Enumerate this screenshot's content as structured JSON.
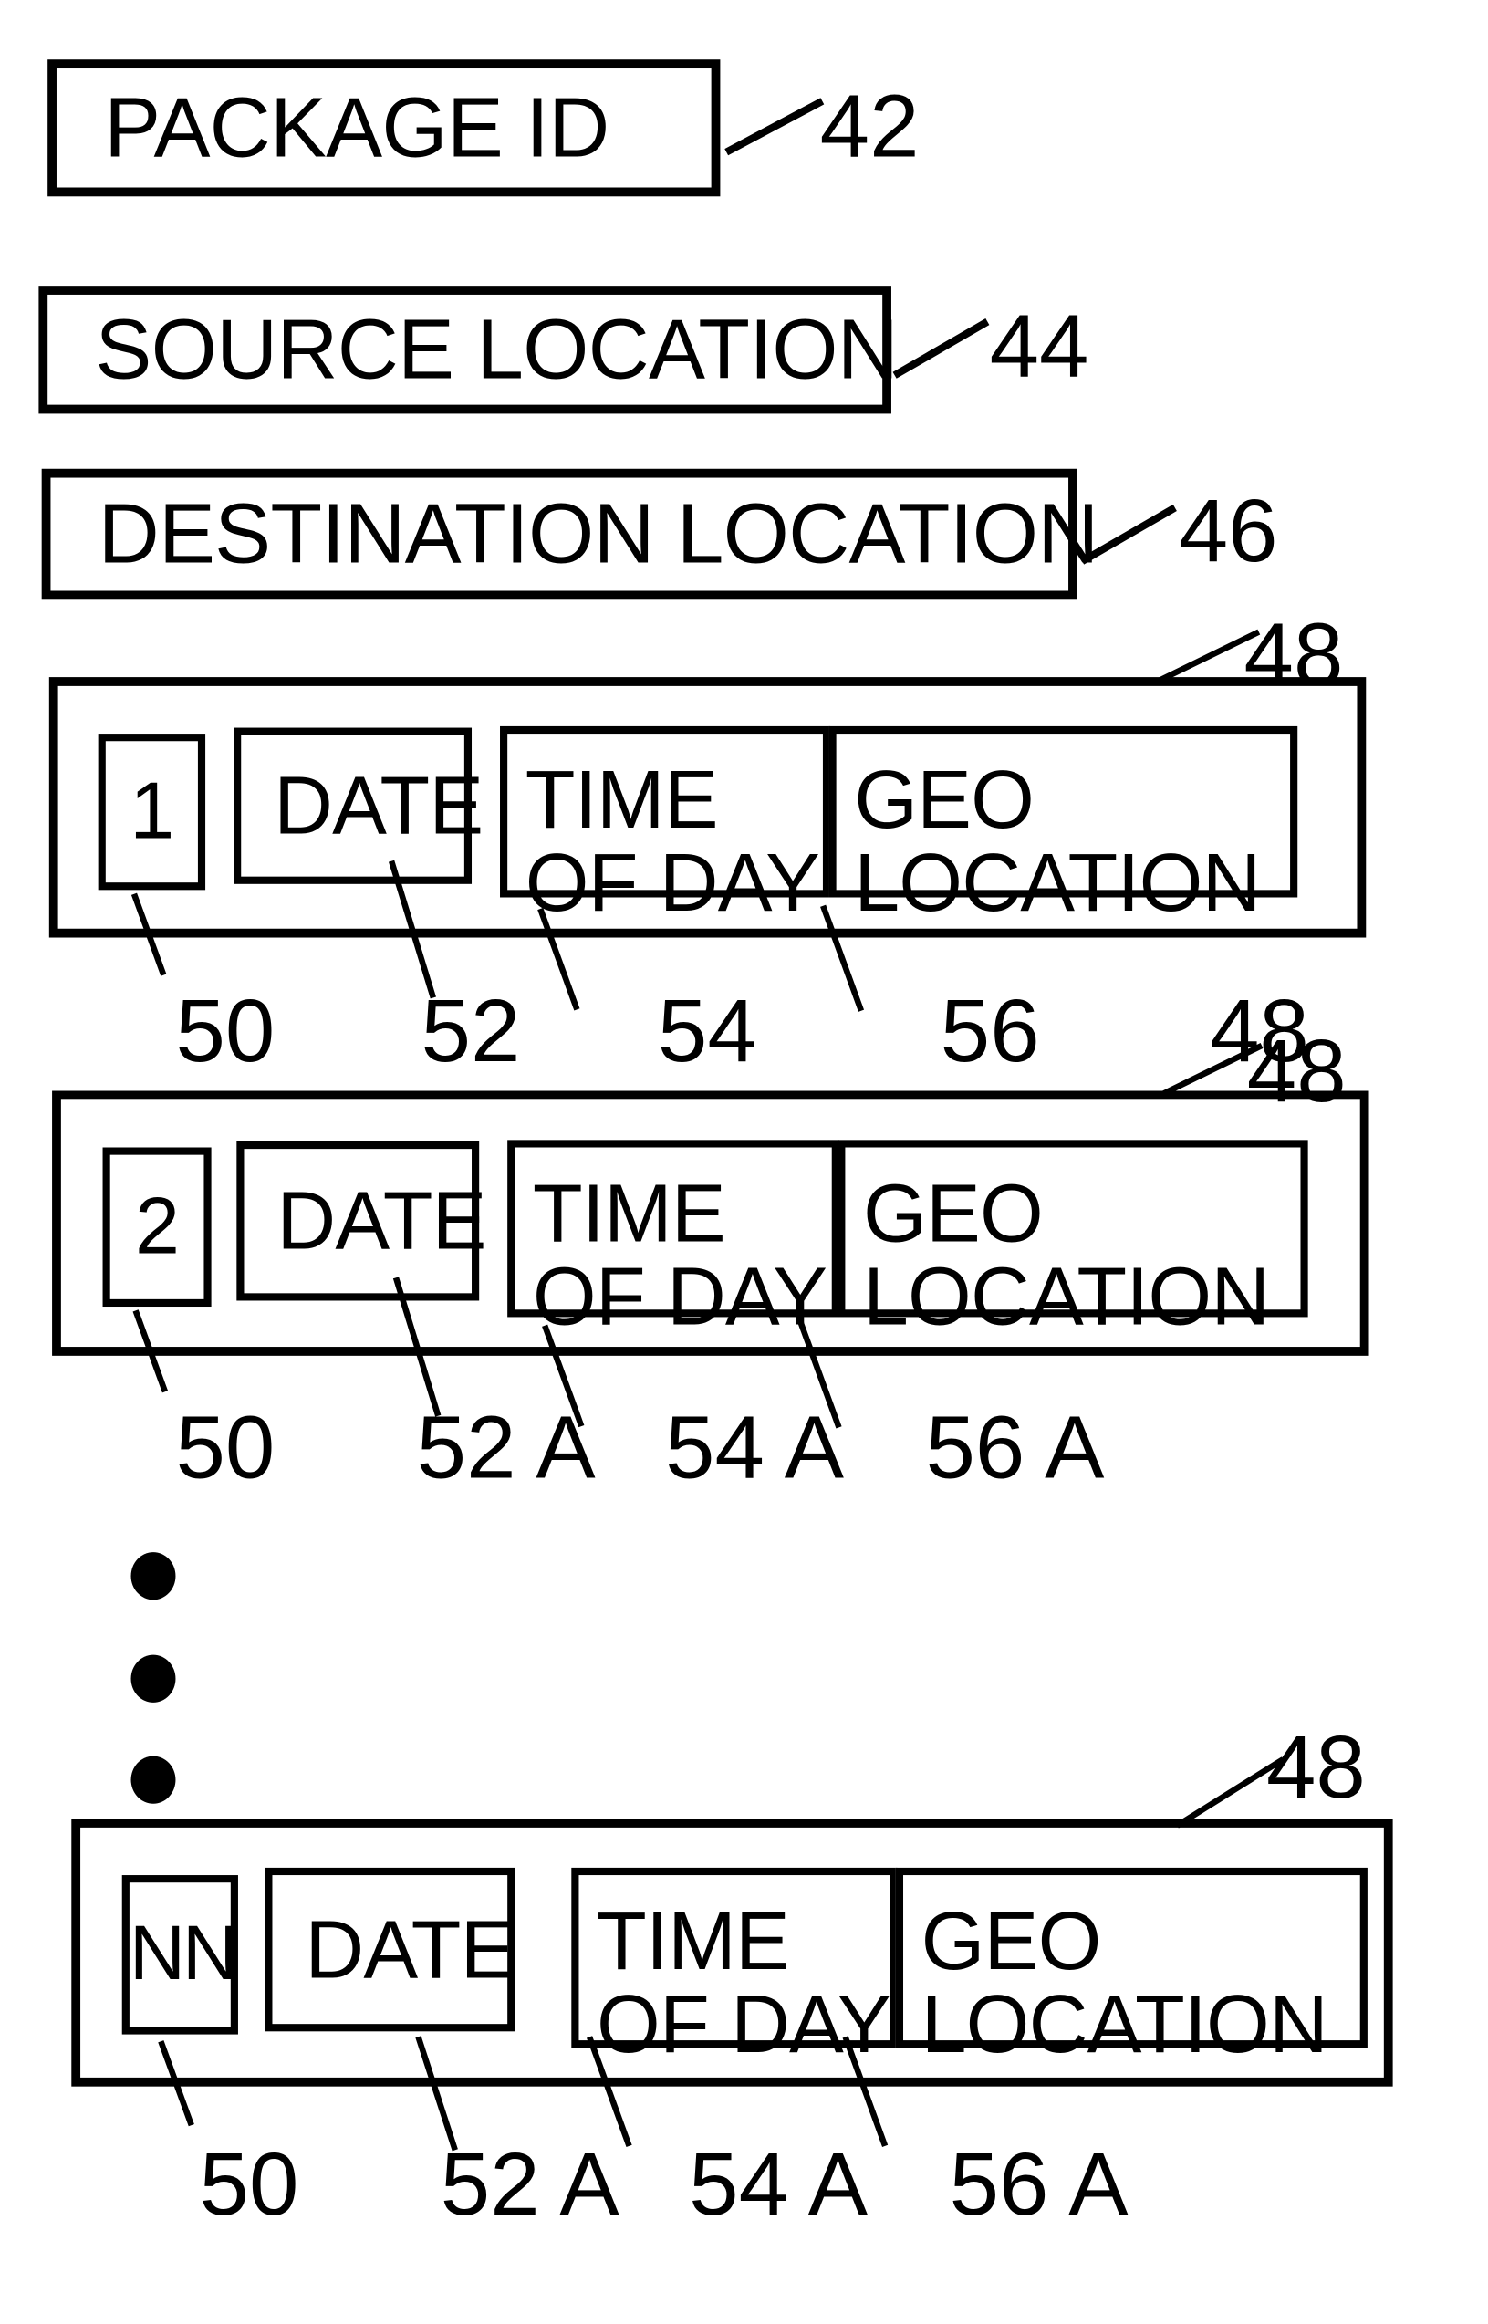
{
  "figure": {
    "kind": "patent-data-structure-diagram",
    "line_color": "#000000",
    "background_color": "#ffffff"
  },
  "fields": [
    {
      "label": "PACKAGE   ID",
      "ref": "42"
    },
    {
      "label": "SOURCE LOCATION",
      "ref": "44"
    },
    {
      "label": "DESTINATION LOCATION",
      "ref": "46"
    }
  ],
  "records": [
    {
      "ref": "48",
      "seq": {
        "value": "1",
        "ref": "50"
      },
      "date": {
        "value": "DATE",
        "ref": "52"
      },
      "time": {
        "line1": "TIME",
        "line2": "OF DAY",
        "ref": "54"
      },
      "geo": {
        "line1": "GEO",
        "line2": "LOCATION",
        "ref": "56"
      }
    },
    {
      "ref": "48",
      "seq": {
        "value": "2",
        "ref": "50"
      },
      "date": {
        "value": "DATE",
        "ref": "52 A"
      },
      "time": {
        "line1": "TIME",
        "line2": "OF DAY",
        "ref": "54 A"
      },
      "geo": {
        "line1": "GEO",
        "line2": "LOCATION",
        "ref": "56 A"
      }
    },
    {
      "ref": "48",
      "seq": {
        "value": "NN",
        "ref": "50"
      },
      "date": {
        "value": "DATE",
        "ref": "52 A"
      },
      "time": {
        "line1": "TIME",
        "line2": "OF DAY",
        "ref": "54 A"
      },
      "geo": {
        "line1": "GEO",
        "line2": "LOCATION",
        "ref": "56 A"
      }
    }
  ],
  "ellipsis": {
    "symbol": "vertical-ellipsis",
    "dot_count": 3
  },
  "extra_refs": {
    "row1_trailing_48": "48"
  }
}
